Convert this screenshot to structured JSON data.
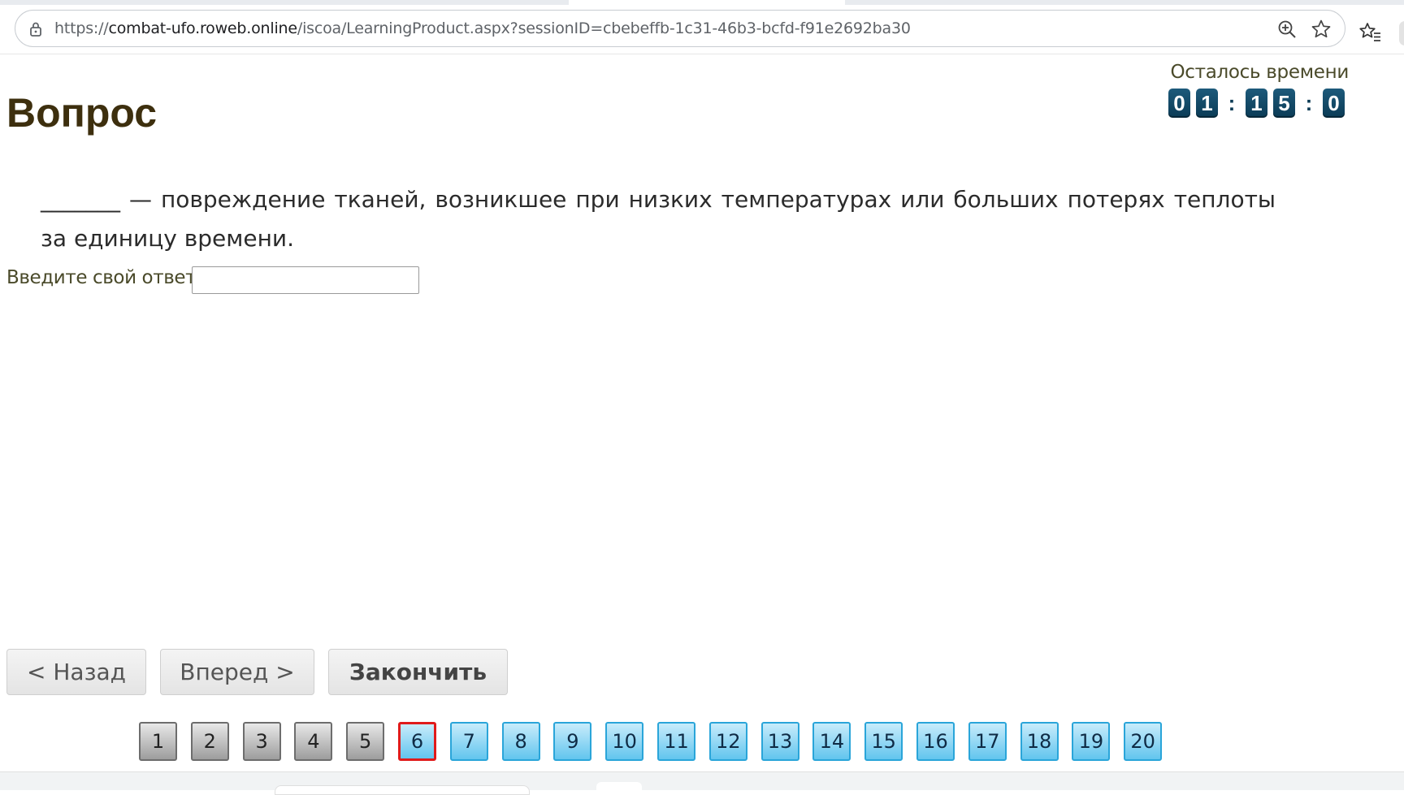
{
  "browser": {
    "url_prefix": "https://",
    "url_host": "combat-ufo.roweb.online",
    "url_path": "/iscoa/LearningProduct.aspx?sessionID=cbebeffb-1c31-46b3-bcfd-f91e2692ba30"
  },
  "page": {
    "title": "Вопрос",
    "timer": {
      "label": "Осталось времени",
      "digits": [
        "0",
        "1",
        "1",
        "5",
        "0"
      ],
      "separator": ":"
    },
    "question_text": "_______ — повреждение тканей, возникшее при низких температурах или больших потерях теплоты за единицу времени.",
    "answer_label": "Введите свой ответ",
    "answer_value": "",
    "buttons": {
      "back": "< Назад",
      "next": "Вперед >",
      "finish": "Закончить"
    },
    "pager": {
      "current": 6,
      "items": [
        {
          "label": "1",
          "state": "done"
        },
        {
          "label": "2",
          "state": "done"
        },
        {
          "label": "3",
          "state": "done"
        },
        {
          "label": "4",
          "state": "done"
        },
        {
          "label": "5",
          "state": "done"
        },
        {
          "label": "6",
          "state": "current"
        },
        {
          "label": "7",
          "state": "todo"
        },
        {
          "label": "8",
          "state": "todo"
        },
        {
          "label": "9",
          "state": "todo"
        },
        {
          "label": "10",
          "state": "todo"
        },
        {
          "label": "11",
          "state": "todo"
        },
        {
          "label": "12",
          "state": "todo"
        },
        {
          "label": "13",
          "state": "todo"
        },
        {
          "label": "14",
          "state": "todo"
        },
        {
          "label": "15",
          "state": "todo"
        },
        {
          "label": "16",
          "state": "todo"
        },
        {
          "label": "17",
          "state": "todo"
        },
        {
          "label": "18",
          "state": "todo"
        },
        {
          "label": "19",
          "state": "todo"
        },
        {
          "label": "20",
          "state": "todo"
        }
      ]
    }
  },
  "colors": {
    "title": "#3d2f0e",
    "timer_digit_bg": "#0b3b55",
    "page_done": "#9d9d9d",
    "page_todo": "#62c5ee",
    "page_current_border": "#e01b1b"
  },
  "icons": {
    "lock": "lock-icon",
    "zoom": "zoom-icon",
    "bookmark": "star-icon",
    "favorites": "favorites-icon"
  }
}
